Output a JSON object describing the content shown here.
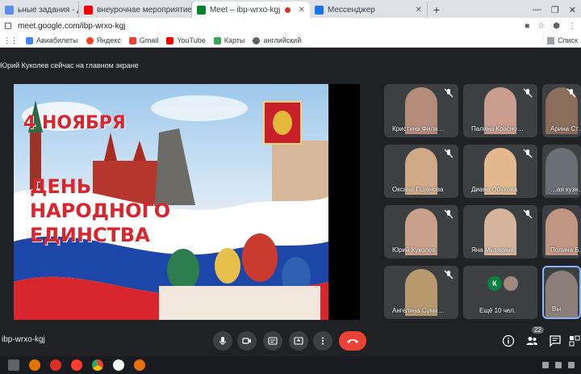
{
  "browser": {
    "tabs": [
      {
        "title": "ьные задания - Дневник.р",
        "icon": "diary-icon",
        "color": "#5b8def",
        "active": false
      },
      {
        "title": "внеурочнае мероприятие в нач",
        "icon": "youtube-icon",
        "color": "#ff0000",
        "active": false
      },
      {
        "title": "Meet – ibp-wrxo-kgj",
        "icon": "meet-icon",
        "color": "#00832d",
        "active": true
      },
      {
        "title": "Мессенджер",
        "icon": "messenger-icon",
        "color": "#1a73e8",
        "active": false
      }
    ],
    "new_tab_label": "+",
    "window_controls": {
      "minimize": "—",
      "restore": "❐",
      "close": "✕"
    },
    "address": "meet.google.com/ibp-wrxo-kgj",
    "bookmarks": [
      {
        "label": "Авиабилеты",
        "icon": "plane-icon",
        "color": "#4285f4"
      },
      {
        "label": "Яндекс",
        "icon": "yandex-icon",
        "color": "#fc3f1d"
      },
      {
        "label": "Gmail",
        "icon": "gmail-icon",
        "color": "#ea4335"
      },
      {
        "label": "YouTube",
        "icon": "youtube-icon",
        "color": "#ff0000"
      },
      {
        "label": "Карты",
        "icon": "maps-icon",
        "color": "#34a853"
      },
      {
        "label": "английский",
        "icon": "globe-icon",
        "color": "#5f6368"
      }
    ],
    "bookmarks_right": "Списк"
  },
  "meet": {
    "presenter_text": "Юрий Куколев сейчас на главном экране",
    "slide": {
      "date_line": "4 НОЯБРЯ",
      "title_lines": [
        "ДЕНЬ",
        "НАРОДНОГО",
        "ЕДИНСТВА"
      ],
      "accent_color": "#d7262e"
    },
    "participants": [
      {
        "name": "Кристина Фили…",
        "muted": true,
        "tone": "#b58b7c"
      },
      {
        "name": "Палина Красно…",
        "muted": true,
        "tone": "#c89c8f"
      },
      {
        "name": "Арина Ст…",
        "muted": true,
        "tone": "#8a6d5a"
      },
      {
        "name": "Оксана Пшенова",
        "muted": true,
        "tone": "#d0a986"
      },
      {
        "name": "Диана Обухова",
        "muted": true,
        "tone": "#e3b88f"
      },
      {
        "name": "…ая кузн…",
        "muted": false,
        "tone": "#6a6f75"
      },
      {
        "name": "Юрий Куколев",
        "muted": true,
        "tone": "#caa18a"
      },
      {
        "name": "Яна Мизякина",
        "muted": true,
        "tone": "#d6b49b"
      },
      {
        "name": "Полина Б…",
        "muted": false,
        "tone": "#c09582"
      },
      {
        "name": "Ангелина Суми…",
        "muted": true,
        "tone": "#b99a6f"
      }
    ],
    "more_tile": {
      "label": "Ещё 10 чел.",
      "avatar_letter": "К",
      "avatar_color": "#0b8043"
    },
    "self_tile": {
      "name": "Вы",
      "tone": "#8c7f78"
    },
    "meeting_code": "ibp-wrxo-kgj",
    "controls": {
      "mic": "mic-icon",
      "camera": "camera-icon",
      "captions": "captions-icon",
      "present": "present-icon",
      "more": "more-icon",
      "end": "end-call-icon"
    },
    "people_count": "22"
  }
}
